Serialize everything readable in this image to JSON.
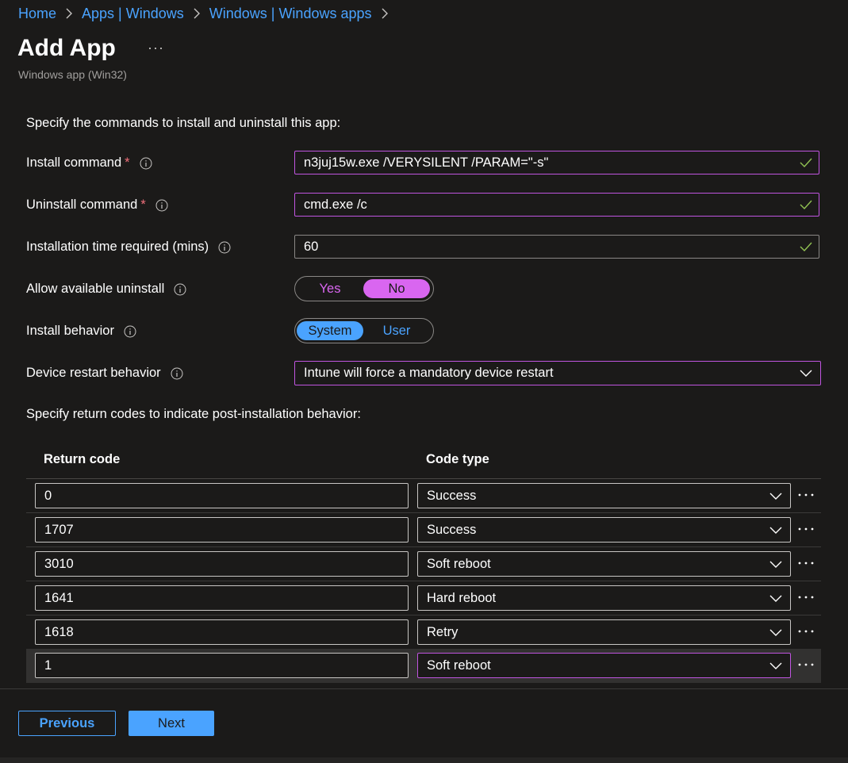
{
  "breadcrumb": [
    "Home",
    "Apps | Windows",
    "Windows | Windows apps"
  ],
  "header": {
    "title": "Add App",
    "more": "···",
    "subtitle": "Windows app (Win32)"
  },
  "program": {
    "intro": "Specify the commands to install and uninstall this app:",
    "install_command": {
      "label": "Install command",
      "required": "*",
      "value": "n3juj15w.exe /VERYSILENT /PARAM=\"-s\""
    },
    "uninstall_command": {
      "label": "Uninstall command",
      "required": "*",
      "value": "cmd.exe /c"
    },
    "install_time": {
      "label": "Installation time required (mins)",
      "value": "60"
    },
    "allow_uninstall": {
      "label": "Allow available uninstall",
      "options": [
        "Yes",
        "No"
      ],
      "selected": "No"
    },
    "install_behavior": {
      "label": "Install behavior",
      "options": [
        "System",
        "User"
      ],
      "selected": "System"
    },
    "restart_behavior": {
      "label": "Device restart behavior",
      "value": "Intune will force a mandatory device restart"
    }
  },
  "return_codes": {
    "intro": "Specify return codes to indicate post-installation behavior:",
    "headers": {
      "code": "Return code",
      "type": "Code type"
    },
    "rows": [
      {
        "code": "0",
        "type": "Success"
      },
      {
        "code": "1707",
        "type": "Success"
      },
      {
        "code": "3010",
        "type": "Soft reboot"
      },
      {
        "code": "1641",
        "type": "Hard reboot"
      },
      {
        "code": "1618",
        "type": "Retry"
      },
      {
        "code": "1",
        "type": "Soft reboot"
      }
    ],
    "row_more": "···"
  },
  "footer": {
    "previous": "Previous",
    "next": "Next"
  },
  "colors": {
    "link": "#4aa3ff",
    "accent": "#c055e0",
    "toggle_purple": "#d966f0",
    "valid_check": "#92c353",
    "required": "#f1707b"
  }
}
